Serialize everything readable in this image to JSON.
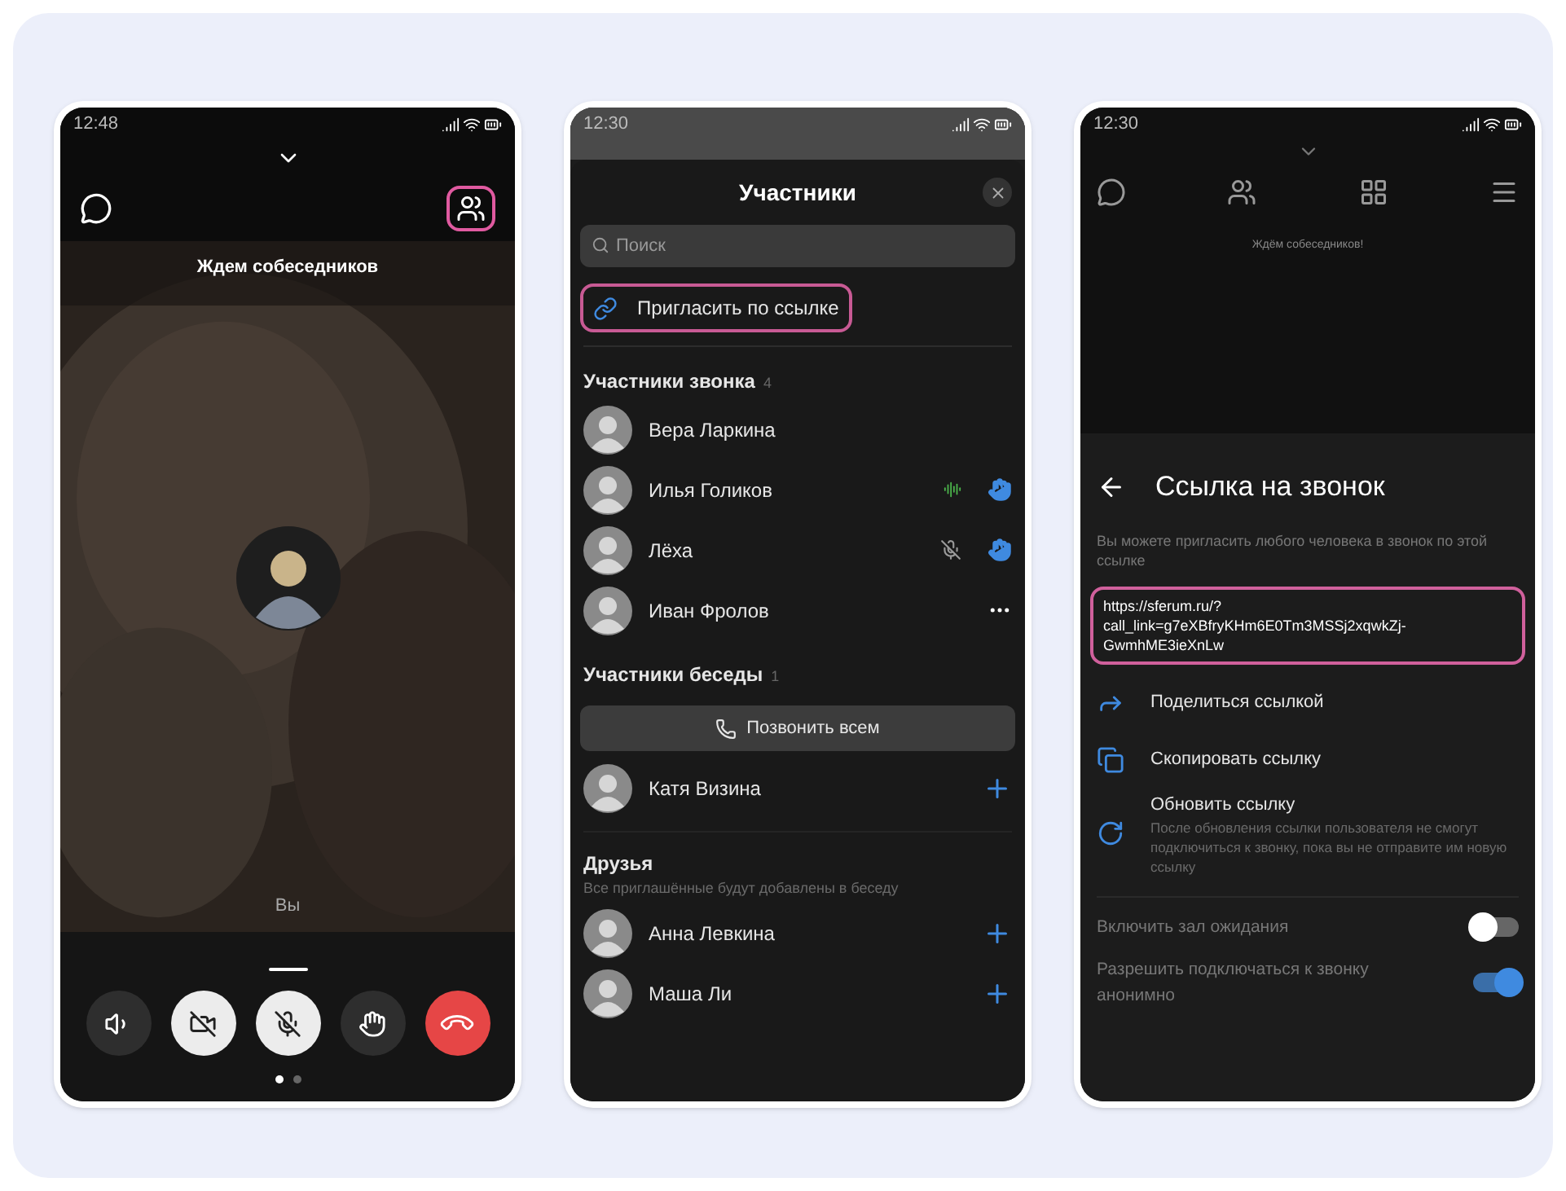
{
  "call_screen": {
    "time": "12:48",
    "people_button": {
      "highlighted": true
    },
    "status_text": "Ждем собеседников",
    "self_label": "Вы",
    "controls": [
      {
        "kind": "speaker"
      },
      {
        "kind": "camera_off"
      },
      {
        "kind": "mic_off"
      },
      {
        "kind": "hand"
      },
      {
        "kind": "end_call"
      }
    ],
    "pages": [
      {
        "selected": true
      },
      {
        "selected": false
      }
    ]
  },
  "participants_screen": {
    "time": "12:30",
    "title": "Участники",
    "search": {
      "placeholder": "Поиск"
    },
    "invite_button": {
      "label": "Пригласить по ссылке",
      "highlighted": true
    },
    "call_section": {
      "title": "Участники звонка",
      "count": "4",
      "members": [
        {
          "name": "Вера Ларкина",
          "speaking": false,
          "muted": false,
          "hand_raised": false,
          "menu": false
        },
        {
          "name": "Илья Голиков",
          "speaking": true,
          "muted": false,
          "hand_raised": true,
          "menu": false
        },
        {
          "name": "Лёха",
          "speaking": false,
          "muted": true,
          "hand_raised": true,
          "menu": false
        },
        {
          "name": "Иван Фролов",
          "speaking": false,
          "muted": false,
          "hand_raised": false,
          "menu": true
        }
      ]
    },
    "chat_section": {
      "title": "Участники беседы",
      "count": "1",
      "call_all_button": "Позвонить всем",
      "members": [
        {
          "name": "Катя Визина"
        }
      ]
    },
    "friends_section": {
      "title": "Друзья",
      "subtitle": "Все приглашённые будут добавлены в беседу",
      "members": [
        {
          "name": "Анна Левкина"
        },
        {
          "name": "Маша Ли"
        }
      ]
    }
  },
  "link_screen": {
    "time": "12:30",
    "status_text": "Ждём собеседников!",
    "title": "Ссылка на звонок",
    "description": "Вы можете пригласить любого человека в звонок по этой ссылке",
    "link": {
      "line_1": "https://sferum.ru/?",
      "line_2": "call_link=g7eXBfryKHm6E0Tm3MSSj2xqwkZj-",
      "line_3": "GwmhME3ieXnLw",
      "highlighted": true
    },
    "actions": [
      {
        "kind": "share",
        "label": "Поделиться ссылкой"
      },
      {
        "kind": "copy",
        "label": "Скопировать ссылку"
      },
      {
        "kind": "refresh",
        "label": "Обновить ссылку",
        "description": "После обновления ссылки пользователя не смогут подключиться к звонку, пока вы не отправите им новую ссылку"
      }
    ],
    "settings": [
      {
        "label": "Включить зал ожидания",
        "on": false
      },
      {
        "label": "Разрешить подключаться к звонку анонимно",
        "on": true
      }
    ]
  }
}
